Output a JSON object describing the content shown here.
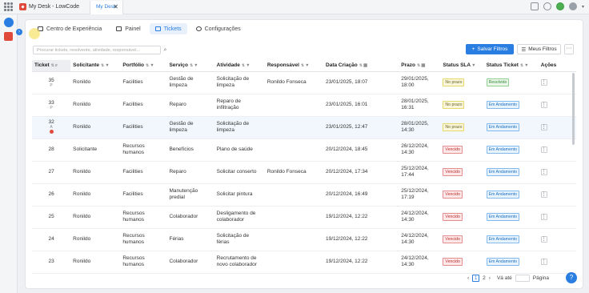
{
  "topbar": {
    "brand_title": "My Desk - LowCode",
    "tab_label": "My Desk",
    "tab_close": "✕"
  },
  "nav": {
    "tabs": [
      {
        "label": "Centro de Experiência"
      },
      {
        "label": "Painel"
      },
      {
        "label": "Tickets",
        "active": true
      },
      {
        "label": "Configurações"
      }
    ]
  },
  "toolbar": {
    "search_placeholder": "Procurar tickets, resolvente, atividade, responsável...",
    "save_filters": "Salvar Filtros",
    "my_filters": "Meus Filtros",
    "more": "···"
  },
  "table": {
    "headers": [
      "Ticket",
      "Solicitante",
      "Portfólio",
      "Serviço",
      "Atividade",
      "Responsável",
      "Data Criação",
      "Prazo",
      "Status SLA",
      "Status Ticket",
      "Ações"
    ],
    "rows": [
      {
        "ticket": "35",
        "ticket_sub": "P",
        "solicitante": "Ronildo",
        "portfolio": "Facilities",
        "servico": "Gestão de limpeza",
        "atividade": "Solicitação de limpeza",
        "responsavel": "Ronildo Fonseca",
        "criacao": "23/01/2025, 18:07",
        "prazo": "29/01/2025, 18:00",
        "sla": "No prazo",
        "status": "Resolvido"
      },
      {
        "ticket": "33",
        "ticket_sub": "P",
        "solicitante": "Ronildo",
        "portfolio": "Facilities",
        "servico": "Reparo",
        "atividade": "Reparo de infiltração",
        "responsavel": "",
        "criacao": "23/01/2025, 16:01",
        "prazo": "28/01/2025, 16:31",
        "sla": "No prazo",
        "status": "Em Andamento"
      },
      {
        "ticket": "32",
        "ticket_sub": "A",
        "solicitante": "Ronildo",
        "portfolio": "Facilities",
        "servico": "Gestão de limpeza",
        "atividade": "Solicitação de limpeza",
        "responsavel": "",
        "criacao": "23/01/2025, 12:47",
        "prazo": "28/01/2025, 14:30",
        "sla": "No prazo",
        "status": "Em Andamento"
      },
      {
        "ticket": "28",
        "ticket_sub": "",
        "solicitante": "Solicitante",
        "portfolio": "Recursos humanos",
        "servico": "Benefícios",
        "atividade": "Plano de saúde",
        "responsavel": "",
        "criacao": "20/12/2024, 18:45",
        "prazo": "26/12/2024, 14:30",
        "sla": "Vencido",
        "status": "Em Andamento"
      },
      {
        "ticket": "27",
        "ticket_sub": "",
        "solicitante": "Ronildo",
        "portfolio": "Facilities",
        "servico": "Reparo",
        "atividade": "Solicitar conserto",
        "responsavel": "Ronildo Fonseca",
        "criacao": "20/12/2024, 17:34",
        "prazo": "25/12/2024, 17:44",
        "sla": "Vencido",
        "status": "Em Andamento"
      },
      {
        "ticket": "26",
        "ticket_sub": "",
        "solicitante": "Ronildo",
        "portfolio": "Facilities",
        "servico": "Manutenção predial",
        "atividade": "Solicitar pintura",
        "responsavel": "",
        "criacao": "20/12/2024, 16:49",
        "prazo": "25/12/2024, 17:19",
        "sla": "Vencido",
        "status": "Em Andamento"
      },
      {
        "ticket": "25",
        "ticket_sub": "",
        "solicitante": "Ronildo",
        "portfolio": "Recursos humanos",
        "servico": "Colaborador",
        "atividade": "Desligamento de colaborador",
        "responsavel": "",
        "criacao": "19/12/2024, 12:22",
        "prazo": "24/12/2024, 14:30",
        "sla": "Vencido",
        "status": "Em Andamento"
      },
      {
        "ticket": "24",
        "ticket_sub": "",
        "solicitante": "Ronildo",
        "portfolio": "Recursos humanos",
        "servico": "Férias",
        "atividade": "Solicitação de férias",
        "responsavel": "",
        "criacao": "19/12/2024, 12:22",
        "prazo": "24/12/2024, 14:30",
        "sla": "Vencido",
        "status": "Em Andamento"
      },
      {
        "ticket": "23",
        "ticket_sub": "",
        "solicitante": "Ronildo",
        "portfolio": "Recursos humanos",
        "servico": "Colaborador",
        "atividade": "Recrutamento de novo colaborador",
        "responsavel": "",
        "criacao": "19/12/2024, 12:22",
        "prazo": "24/12/2024, 14:30",
        "sla": "Vencido",
        "status": "Em Andamento"
      }
    ]
  },
  "pagination": {
    "prev": "‹",
    "pages": [
      "1",
      "2"
    ],
    "next": "›",
    "go_to": "Vá até",
    "page_label": "Página"
  },
  "colors": {
    "accent": "#2a7de1",
    "overdue": "#c22f2f",
    "on_time": "#6d6320",
    "resolved": "#3a8a3a"
  }
}
